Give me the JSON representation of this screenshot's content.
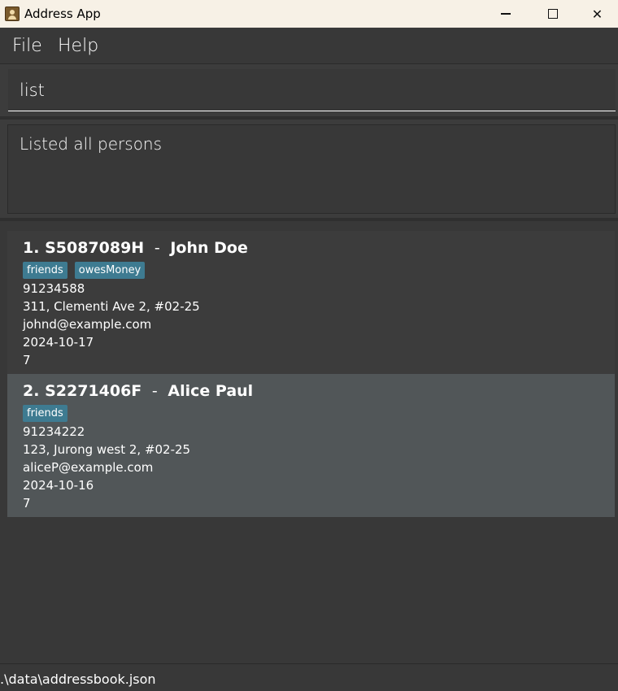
{
  "window": {
    "title": "Address App",
    "minimize_glyph": "",
    "maximize_glyph": "",
    "close_glyph": "✕"
  },
  "menu": {
    "file": "File",
    "help": "Help"
  },
  "command": {
    "value": "list"
  },
  "result": {
    "message": "Listed all persons"
  },
  "persons": [
    {
      "index": "1.",
      "nric": "S5087089H",
      "name": "John Doe",
      "tags": [
        "friends",
        "owesMoney"
      ],
      "phone": "91234588",
      "address": "311, Clementi Ave 2, #02-25",
      "email": "johnd@example.com",
      "date": "2024-10-17",
      "count": "7"
    },
    {
      "index": "2.",
      "nric": "S2271406F",
      "name": "Alice Paul",
      "tags": [
        "friends"
      ],
      "phone": "91234222",
      "address": "123, Jurong west 2, #02-25",
      "email": "aliceP@example.com",
      "date": "2024-10-16",
      "count": "7"
    }
  ],
  "status": {
    "file_path": ".\\data\\addressbook.json"
  },
  "colors": {
    "background": "#3c3c3c",
    "panel": "#383838",
    "selected_card": "#515658",
    "tag": "#3e7b91",
    "titlebar": "#f7f1e6"
  }
}
